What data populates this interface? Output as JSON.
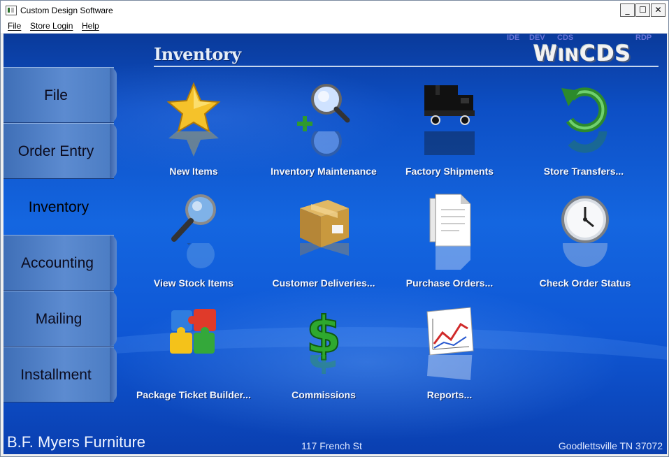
{
  "window": {
    "title": "Custom Design Software",
    "buttons": [
      "_",
      "☐",
      "✕"
    ]
  },
  "menu": [
    {
      "label": "File"
    },
    {
      "label": "Store Login"
    },
    {
      "label": "Help"
    }
  ],
  "header": {
    "section_title": "Inventory",
    "env_tags": [
      "IDE",
      "DEV",
      "CDS",
      "RDP"
    ],
    "logo": {
      "big1": "W",
      "small1": "IN",
      "big2": "CDS"
    }
  },
  "tabs": [
    {
      "label": "File",
      "active": false
    },
    {
      "label": "Order Entry",
      "active": false
    },
    {
      "label": "Inventory",
      "active": true
    },
    {
      "label": "Accounting",
      "active": false
    },
    {
      "label": "Mailing",
      "active": false
    },
    {
      "label": "Installment",
      "active": false
    }
  ],
  "tiles": [
    {
      "label": "New Items",
      "icon": "star-icon"
    },
    {
      "label": "Inventory Maintenance",
      "icon": "magnifier-plus-icon"
    },
    {
      "label": "Factory Shipments",
      "icon": "truck-icon"
    },
    {
      "label": "Store Transfers...",
      "icon": "undo-arrow-icon"
    },
    {
      "label": "View Stock Items",
      "icon": "magnifier-icon"
    },
    {
      "label": "Customer Deliveries...",
      "icon": "package-icon"
    },
    {
      "label": "Purchase Orders...",
      "icon": "documents-icon"
    },
    {
      "label": "Check Order Status",
      "icon": "clock-icon"
    },
    {
      "label": "Package Ticket Builder...",
      "icon": "puzzle-icon"
    },
    {
      "label": "Commissions",
      "icon": "dollar-icon"
    },
    {
      "label": "Reports...",
      "icon": "chart-report-icon"
    }
  ],
  "footer": {
    "store_name": "B.F. Myers Furniture",
    "address": "117 French St",
    "city": "Goodlettsville TN 37072"
  },
  "colors": {
    "background": "#1466e0",
    "tab": "#5c8bd0",
    "label": "#f4f8ff"
  }
}
